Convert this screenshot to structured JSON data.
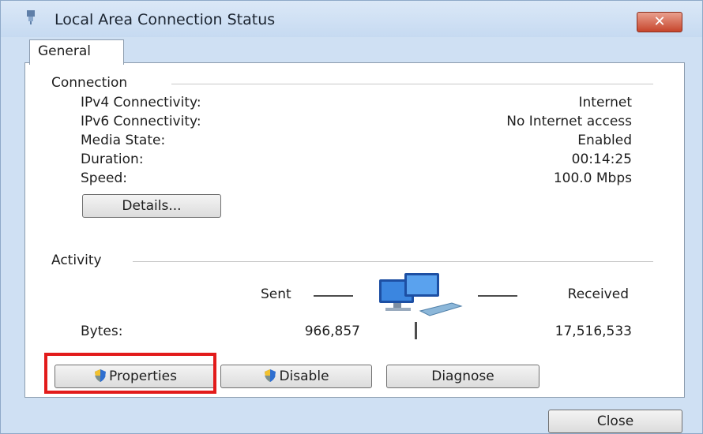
{
  "window": {
    "title": "Local Area Connection Status",
    "close_glyph": "✕"
  },
  "tabs": [
    {
      "label": "General",
      "selected": true
    }
  ],
  "connection": {
    "heading": "Connection",
    "rows": [
      {
        "label": "IPv4 Connectivity:",
        "value": "Internet"
      },
      {
        "label": "IPv6 Connectivity:",
        "value": "No Internet access"
      },
      {
        "label": "Media State:",
        "value": "Enabled"
      },
      {
        "label": "Duration:",
        "value": "00:14:25"
      },
      {
        "label": "Speed:",
        "value": "100.0 Mbps"
      }
    ],
    "details_button": "Details..."
  },
  "activity": {
    "heading": "Activity",
    "sent_label": "Sent",
    "received_label": "Received",
    "bytes_label": "Bytes:",
    "bytes_sent": "966,857",
    "bytes_received": "17,516,533",
    "icon": "network-computers-icon"
  },
  "buttons": {
    "properties": "Properties",
    "disable": "Disable",
    "diagnose": "Diagnose",
    "close": "Close"
  },
  "colors": {
    "highlight": "#e21b1b",
    "window_frame": "#cfe0f3"
  }
}
